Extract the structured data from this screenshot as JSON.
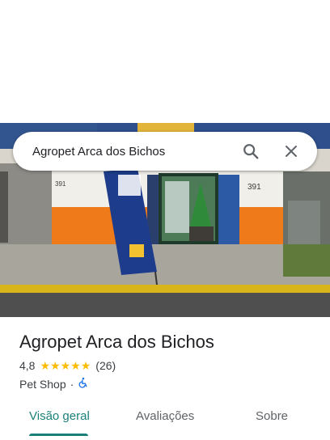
{
  "search": {
    "query": "Agropet Arca dos Bichos"
  },
  "place": {
    "name": "Agropet Arca dos Bichos",
    "rating": "4,8",
    "stars": 5,
    "review_count": "(26)",
    "category": "Pet Shop",
    "separator": "·"
  },
  "tabs": [
    {
      "label": "Visão geral",
      "active": true
    },
    {
      "label": "Avaliações",
      "active": false
    },
    {
      "label": "Sobre",
      "active": false
    }
  ],
  "icons": {
    "search": "search-icon",
    "close": "close-icon",
    "accessibility": "wheelchair-icon"
  },
  "colors": {
    "accent": "#1a7f78",
    "star": "#fbbc04",
    "accessibility": "#1a73e8"
  }
}
